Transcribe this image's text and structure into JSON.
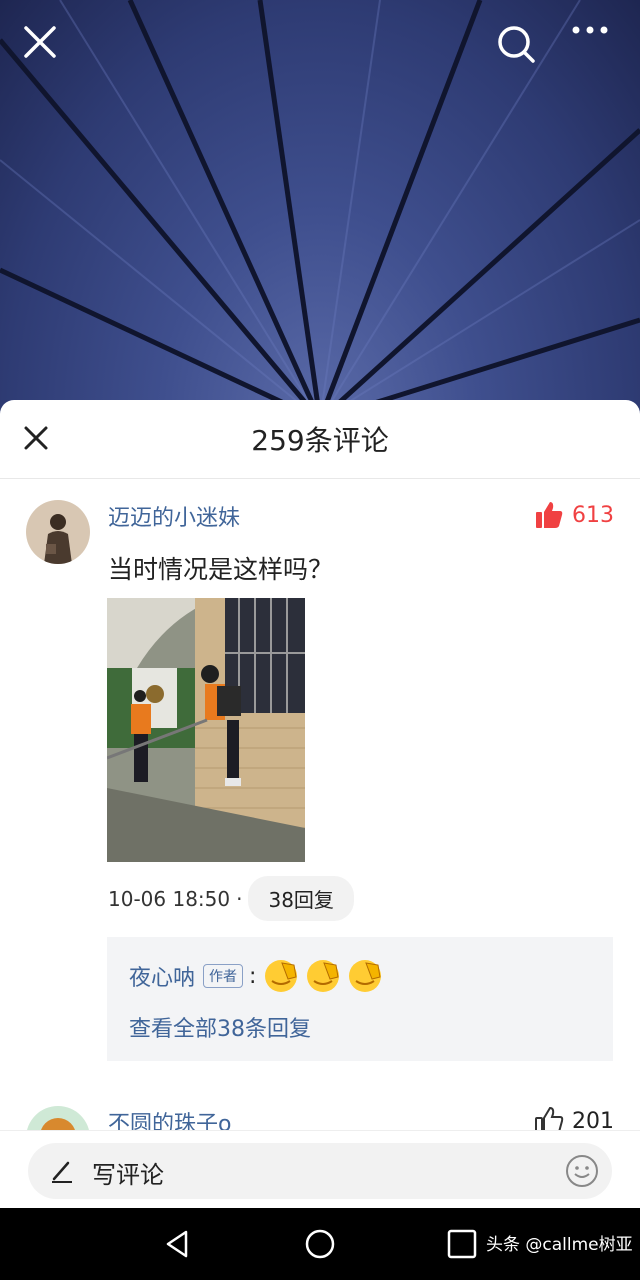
{
  "header": {
    "close_icon": "close-icon",
    "search_icon": "search-icon",
    "more_icon": "more-icon"
  },
  "sheet": {
    "title": "259条评论"
  },
  "comments": [
    {
      "username": "迈迈的小迷妹",
      "likes": "613",
      "liked": true,
      "text": "当时情况是这样吗？",
      "timestamp": "10-06 18:50",
      "replies_label": "38回复",
      "reply_preview": {
        "user": "夜心呐",
        "author_tag": "作者",
        "emoji_count": 3
      },
      "view_all": "查看全部38条回复"
    },
    {
      "username": "不圆的珠子o",
      "likes": "201",
      "liked": false
    }
  ],
  "input": {
    "placeholder": "写评论"
  },
  "watermark": "头条 @callme树亚",
  "colors": {
    "link_blue": "#406599",
    "like_red": "#f04142",
    "sheet_bg": "#ffffff"
  }
}
